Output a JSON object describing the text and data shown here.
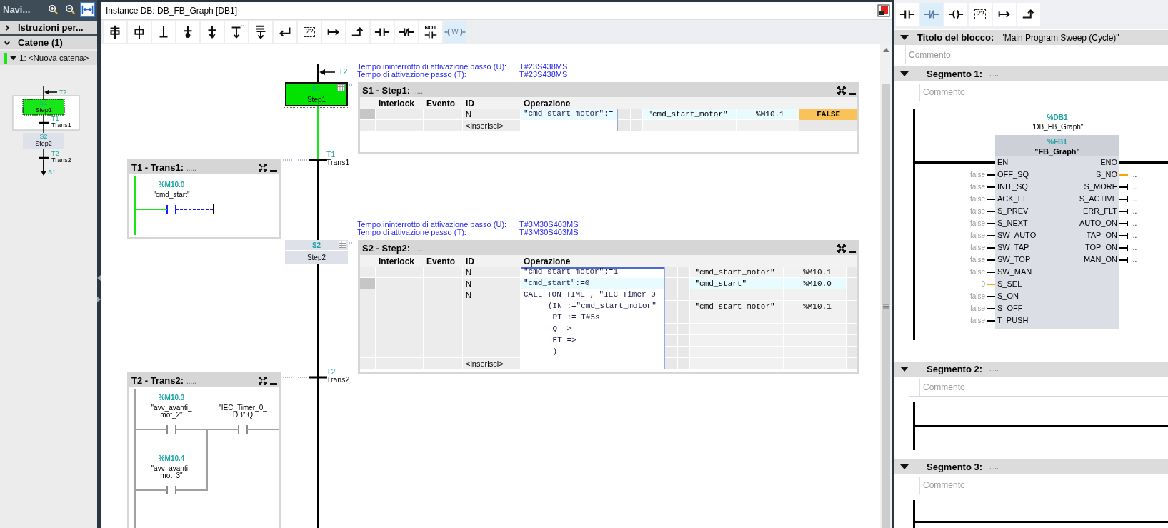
{
  "navigator": {
    "title": "Navi...",
    "tools": [
      {
        "kind": "zoom-in",
        "selected": false
      },
      {
        "kind": "zoom-out",
        "selected": false
      },
      {
        "kind": "fit-width",
        "selected": true
      }
    ],
    "sections": [
      {
        "label": "Istruzioni per...",
        "expanded": false
      },
      {
        "label": "Catene (1)",
        "expanded": true
      }
    ],
    "chains": [
      {
        "label": "1: <Nuova catena>",
        "expanded": true,
        "active": true
      }
    ],
    "overview": {
      "entry": "T2",
      "steps": [
        {
          "number": "S1",
          "name": "Step1",
          "active": true
        },
        {
          "number": "S2",
          "name": "Step2",
          "active": false
        }
      ],
      "transitions": [
        {
          "number": "T1",
          "name": "Trans1"
        },
        {
          "number": "T2",
          "name": "Trans2"
        }
      ],
      "jump_target": "S1"
    }
  },
  "editor": {
    "title": "Instance DB: DB_FB_Graph [DB1]",
    "toolbar": [
      {
        "kind": "step-transition",
        "selected": false
      },
      {
        "kind": "step",
        "selected": false
      },
      {
        "kind": "transition",
        "selected": false
      },
      {
        "kind": "branch-point",
        "selected": false
      },
      {
        "kind": "stop",
        "selected": false
      },
      {
        "kind": "alt-branch",
        "selected": false
      },
      {
        "kind": "sim-branch",
        "selected": false
      },
      {
        "kind": "return",
        "selected": false
      },
      {
        "kind": "empty-box",
        "label": "??",
        "selected": false
      },
      {
        "kind": "jump",
        "selected": false
      },
      {
        "kind": "open-branch",
        "selected": false
      },
      {
        "kind": "contact-no",
        "selected": false
      },
      {
        "kind": "contact-nc",
        "selected": false
      },
      {
        "kind": "contact-not",
        "label": "NOT",
        "selected": false
      },
      {
        "kind": "coil",
        "label": "W",
        "selected": true
      }
    ],
    "chain": {
      "entry_label": "T2",
      "steps": [
        {
          "number": "S1",
          "name": "Step1",
          "active": true,
          "time_u_label": "Tempo ininterrotto di attivazione passo (U):",
          "time_u": "T#23S438MS",
          "time_t_label": "Tempo di attivazione passo (T):",
          "time_t": "T#23S438MS",
          "title": "S1 - Step1:",
          "comment": ".....",
          "columns": [
            "Interlock",
            "Evento",
            "ID",
            "Operazione"
          ],
          "rows": [
            {
              "id": "N",
              "selected": true,
              "lines": [
                {
                  "kind": "statement",
                  "code": "\"cmd_start_motor\":=",
                  "tag": "\"cmd_start_motor\"",
                  "address": "%M10.1",
                  "value": "FALSE"
                }
              ]
            },
            {
              "id": "<inserisci>",
              "selected": false,
              "lines": []
            }
          ]
        },
        {
          "number": "S2",
          "name": "Step2",
          "active": false,
          "time_u_label": "Tempo ininterrotto di attivazione passo (U):",
          "time_u": "T#3M30S403MS",
          "time_t_label": "Tempo di attivazione passo (T):",
          "time_t": "T#3M30S403MS",
          "title": "S2 - Step2:",
          "comment": ".....",
          "columns": [
            "Interlock",
            "Evento",
            "ID",
            "Operazione"
          ],
          "rows": [
            {
              "id": "N",
              "selected": false,
              "lines": [
                {
                  "kind": "statement",
                  "code": "\"cmd_start_motor\":=1",
                  "tag": "\"cmd_start_motor\"",
                  "address": "%M10.1"
                }
              ]
            },
            {
              "id": "N",
              "selected": true,
              "lines": [
                {
                  "kind": "statement",
                  "code": "\"cmd_start\":=0",
                  "tag": "\"cmd_start\"",
                  "address": "%M10.0"
                }
              ]
            },
            {
              "id": "N",
              "selected": false,
              "lines": [
                {
                  "kind": "statement",
                  "code": "CALL TON TIME , \"IEC_Timer_0_"
                },
                {
                  "kind": "parameter",
                  "code": "(IN :=\"cmd_start_motor\"",
                  "tag": "\"cmd_start_motor\"",
                  "address": "%M10.1"
                },
                {
                  "kind": "parameter",
                  "code": " PT := T#5s"
                },
                {
                  "kind": "parameter",
                  "code": " Q =>"
                },
                {
                  "kind": "parameter",
                  "code": " ET =>"
                },
                {
                  "kind": "parameter",
                  "code": " )"
                }
              ]
            },
            {
              "id": "<inserisci>",
              "selected": false,
              "lines": []
            }
          ]
        }
      ],
      "transitions": [
        {
          "number": "T1",
          "name": "Trans1",
          "title": "T1 - Trans1:",
          "comment": ".....",
          "energized": true,
          "rows": [
            [
              {
                "address": "%M10.0",
                "tag": [
                  "\"cmd_start\""
                ],
                "kind": "unknown"
              }
            ]
          ]
        },
        {
          "number": "T2",
          "name": "Trans2",
          "title": "T2 - Trans2:",
          "comment": ".....",
          "energized": false,
          "rows": [
            [
              {
                "address": "%M10.3",
                "tag": [
                  "\"avv_avanti_",
                  "mot_2\""
                ],
                "kind": "normal"
              },
              {
                "tag": [
                  "\"IEC_Timer_0_",
                  "DB\".Q"
                ],
                "kind": "normal"
              }
            ],
            [
              {
                "address": "%M10.4",
                "tag": [
                  "\"avv_avanti_",
                  "mot_3\""
                ],
                "kind": "normal"
              }
            ]
          ]
        }
      ]
    }
  },
  "block_editor": {
    "toolbar": [
      {
        "kind": "contact-no",
        "selected": false
      },
      {
        "kind": "contact-nc",
        "selected": true
      },
      {
        "kind": "coil",
        "selected": false
      },
      {
        "kind": "empty-box",
        "label": "??",
        "selected": false
      },
      {
        "kind": "jump",
        "selected": false
      },
      {
        "kind": "open-branch",
        "selected": false
      }
    ],
    "title": {
      "label": "Titolo del blocco:",
      "value": "\"Main Program Sweep (Cycle)\"",
      "expanded": true,
      "comment_placeholder": "Commento"
    },
    "segments": [
      {
        "title": "Segmento 1:",
        "comment": ".....",
        "expanded": true,
        "comment_placeholder": "Commento",
        "block": {
          "instance_address": "%DB1",
          "instance_name": "\"DB_FB_Graph\"",
          "address": "%FB1",
          "name": "\"FB_Graph\"",
          "inputs": [
            {
              "pin": "EN",
              "kind": "enable"
            },
            {
              "pin": "OFF_SQ",
              "value": "false",
              "color": "#000000"
            },
            {
              "pin": "INIT_SQ",
              "value": "false",
              "color": "#000000"
            },
            {
              "pin": "ACK_EF",
              "value": "false",
              "color": "#000000"
            },
            {
              "pin": "S_PREV",
              "value": "false",
              "color": "#000000"
            },
            {
              "pin": "S_NEXT",
              "value": "false",
              "color": "#000000"
            },
            {
              "pin": "SW_AUTO",
              "value": "false",
              "color": "#000000"
            },
            {
              "pin": "SW_TAP",
              "value": "false",
              "color": "#000000"
            },
            {
              "pin": "SW_TOP",
              "value": "false",
              "color": "#000000"
            },
            {
              "pin": "SW_MAN",
              "value": "false",
              "color": "#000000"
            },
            {
              "pin": "S_SEL",
              "value": "0",
              "color": "#f5a800"
            },
            {
              "pin": "S_ON",
              "value": "false",
              "color": "#000000"
            },
            {
              "pin": "S_OFF",
              "value": "false",
              "color": "#000000"
            },
            {
              "pin": "T_PUSH",
              "value": "false",
              "color": "#000000"
            }
          ],
          "outputs": [
            {
              "pin": "ENO",
              "kind": "enable"
            },
            {
              "pin": "S_NO",
              "value": "...",
              "color": "#f5a800"
            },
            {
              "pin": "S_MORE",
              "value": "...",
              "color": "#000000"
            },
            {
              "pin": "S_ACTIVE",
              "value": "...",
              "color": "#000000"
            },
            {
              "pin": "ERR_FLT",
              "value": "...",
              "color": "#000000"
            },
            {
              "pin": "AUTO_ON",
              "value": "...",
              "color": "#000000"
            },
            {
              "pin": "TAP_ON",
              "value": "...",
              "color": "#000000"
            },
            {
              "pin": "TOP_ON",
              "value": "...",
              "color": "#000000"
            },
            {
              "pin": "MAN_ON",
              "value": "...",
              "color": "#000000"
            }
          ]
        }
      },
      {
        "title": "Segmento 2:",
        "comment": ".....",
        "expanded": true,
        "comment_placeholder": "Commento"
      },
      {
        "title": "Segmento 3:",
        "comment": ".....",
        "expanded": true,
        "comment_placeholder": "Commento"
      }
    ]
  }
}
